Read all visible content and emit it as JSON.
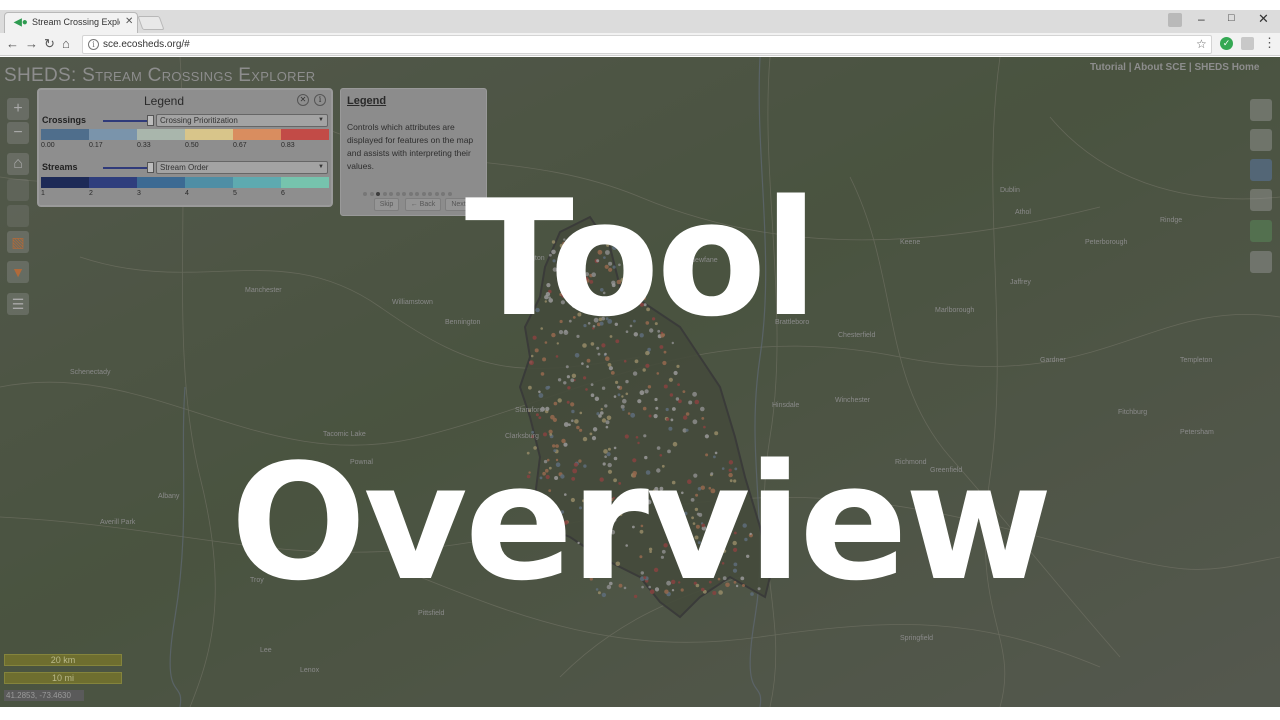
{
  "browser": {
    "tab_title": "Stream Crossing Explore",
    "tab_favicon": "fish-icon",
    "url": "sce.ecosheds.org/#"
  },
  "app": {
    "title": "SHEDS: Stream Crossings Explorer",
    "top_links": "Tutorial | About SCE | SHEDS Home"
  },
  "legend": {
    "title": "Legend",
    "crossings_label": "Crossings",
    "crossings_select": "Crossing Prioritization",
    "crossings_ticks": [
      "0.00",
      "0.17",
      "0.33",
      "0.50",
      "0.67",
      "0.83"
    ],
    "crossings_colors": [
      "#4f6e8c",
      "#7a94ab",
      "#a9b6ac",
      "#d8c58a",
      "#d98d5f",
      "#c24b47"
    ],
    "streams_label": "Streams",
    "streams_select": "Stream Order",
    "streams_ticks": [
      "1",
      "2",
      "3",
      "4",
      "5",
      "6"
    ],
    "streams_colors": [
      "#1d2a57",
      "#2f3e7d",
      "#3c6a93",
      "#4f8ea5",
      "#5eaab0",
      "#76c3ad"
    ]
  },
  "tour": {
    "title": "Legend",
    "body": "Controls which attributes are displayed for features on the map and assists with interpreting their values.",
    "skip": "Skip",
    "back": "← Back",
    "next": "Next →"
  },
  "scale": {
    "km": "20 km",
    "mi": "10 mi"
  },
  "coords": "41.2853, -73.4630",
  "map_labels": [
    "Schenectady",
    "Albany",
    "Pittsfield",
    "Bennington",
    "Brattleboro",
    "Keene",
    "Peterborough",
    "Fitchburg",
    "Springfield",
    "Chesterfield",
    "Williamstown",
    "Wilmington",
    "Hinsdale",
    "Newfane",
    "Marlborough",
    "Greenfield",
    "Jaffrey",
    "Templeton",
    "Athol",
    "Petersham",
    "Dublin",
    "Rindge",
    "Gardner",
    "Winchester",
    "Richmond",
    "Pownal",
    "Stamford",
    "Clarksburg",
    "Manchester",
    "Tacomic Lake",
    "Averill Park",
    "Troy",
    "Lee",
    "Lenox"
  ],
  "overlay": {
    "line1": "Tool",
    "line2": "Overview"
  },
  "colors": {
    "dim": "#373737",
    "tour_panel": "#8c8c8c",
    "scale": "#6e6e2f"
  }
}
